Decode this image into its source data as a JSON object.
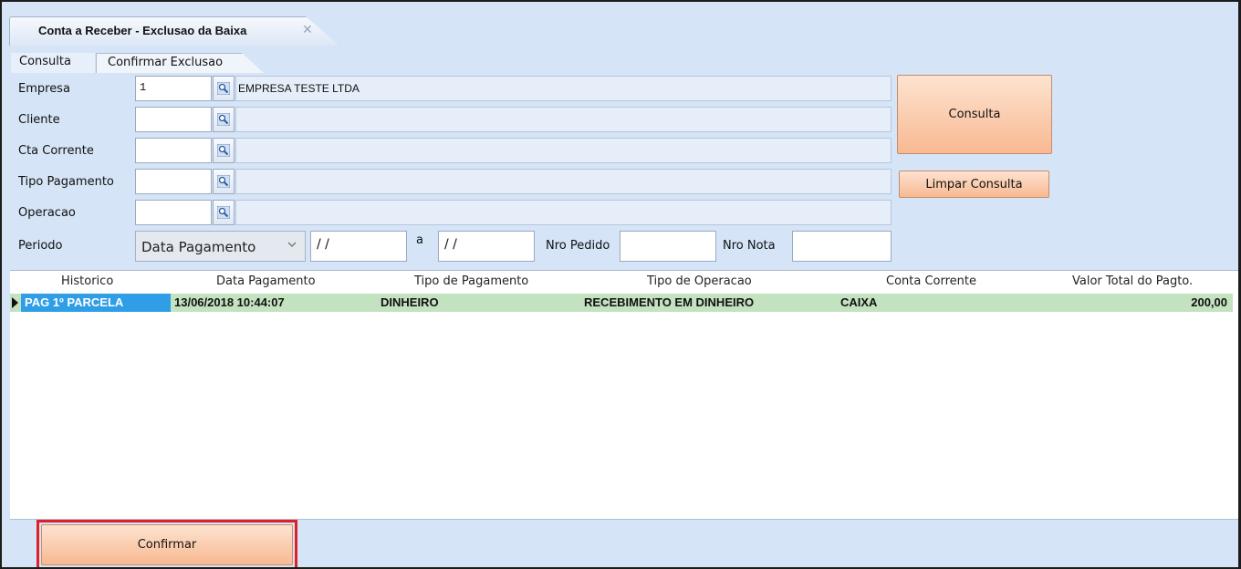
{
  "window": {
    "tab_title": "Conta a Receber - Exclusao da Baixa",
    "tab_close_glyph": "✕"
  },
  "subtabs": [
    {
      "label": "Consulta",
      "active": true
    },
    {
      "label": "Confirmar Exclusao",
      "active": false
    }
  ],
  "filters": {
    "empresa": {
      "label": "Empresa",
      "code": "1",
      "description": "EMPRESA TESTE LTDA"
    },
    "cliente": {
      "label": "Cliente",
      "code": "",
      "description": ""
    },
    "cta_corrente": {
      "label": "Cta Corrente",
      "code": "",
      "description": ""
    },
    "tipo_pagamento": {
      "label": "Tipo Pagamento",
      "code": "",
      "description": ""
    },
    "operacao": {
      "label": "Operacao",
      "code": "",
      "description": ""
    },
    "periodo": {
      "label": "Periodo",
      "select_value": "Data Pagamento",
      "date_from": "/ /",
      "separator": "a",
      "date_to": "/ /",
      "nro_pedido_label": "Nro Pedido",
      "nro_pedido_value": "",
      "nro_nota_label": "Nro Nota",
      "nro_nota_value": ""
    }
  },
  "buttons": {
    "consulta": "Consulta",
    "limpar_consulta": "Limpar Consulta",
    "confirmar": "Confirmar"
  },
  "grid": {
    "columns": [
      "Historico",
      "Data Pagamento",
      "Tipo de Pagamento",
      "Tipo de Operacao",
      "Conta Corrente",
      "Valor Total do Pagto."
    ],
    "rows": [
      {
        "historico": "PAG 1º PARCELA",
        "data_pagamento": "13/06/2018 10:44:07",
        "tipo_pagamento": "DINHEIRO",
        "tipo_operacao": "RECEBIMENTO EM DINHEIRO",
        "conta_corrente": "CAIXA",
        "valor_total": "200,00"
      }
    ]
  },
  "colors": {
    "window_bg": "#d5e4f6",
    "button_orange": "#f8b992",
    "row_highlight": "#c3e2c0",
    "cell_selected": "#2f9ee6",
    "confirm_outline": "#e01f26"
  },
  "icons": {
    "lookup": "magnifier-icon",
    "row_indicator": "row-pointer-icon",
    "dropdown": "chevron-down-icon"
  }
}
